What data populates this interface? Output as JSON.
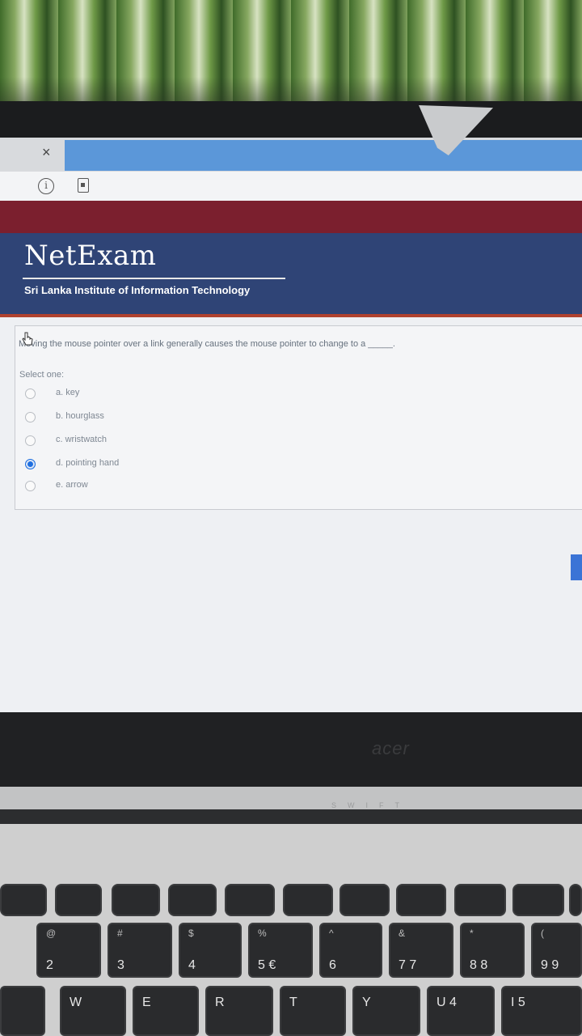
{
  "browser": {
    "tab_close_glyph": "×",
    "info_icon_glyph": "i"
  },
  "header": {
    "brand": "NetExam",
    "subtitle": "Sri Lanka Institute of Information Technology"
  },
  "question": {
    "text": "Moving the mouse pointer over a link generally causes the mouse pointer to change to a _____.",
    "select_label": "Select one:",
    "options": [
      {
        "label": "a. key",
        "selected": false
      },
      {
        "label": "b. hourglass",
        "selected": false
      },
      {
        "label": "c. wristwatch",
        "selected": false
      },
      {
        "label": "d. pointing hand",
        "selected": true
      },
      {
        "label": "e. arrow",
        "selected": false
      }
    ]
  },
  "laptop": {
    "brand": "acer",
    "hinge_text": "SWIFT"
  },
  "keyboard": {
    "number_row": [
      {
        "top": "@",
        "main": "2"
      },
      {
        "top": "#",
        "main": "3"
      },
      {
        "top": "$",
        "main": "4"
      },
      {
        "top": "%",
        "main": "5  €"
      },
      {
        "top": "^",
        "main": "6"
      },
      {
        "top": "&",
        "main": "7  7"
      },
      {
        "top": "*",
        "main": "8  8"
      },
      {
        "top": "(",
        "main": "9  9"
      }
    ],
    "letter_row": [
      "W",
      "E",
      "R",
      "T",
      "Y",
      "U  4",
      "I  5"
    ]
  },
  "colors": {
    "header_blue": "#2f4476",
    "maroon": "#7b1f2e",
    "radio_selected": "#1f6fe0"
  }
}
